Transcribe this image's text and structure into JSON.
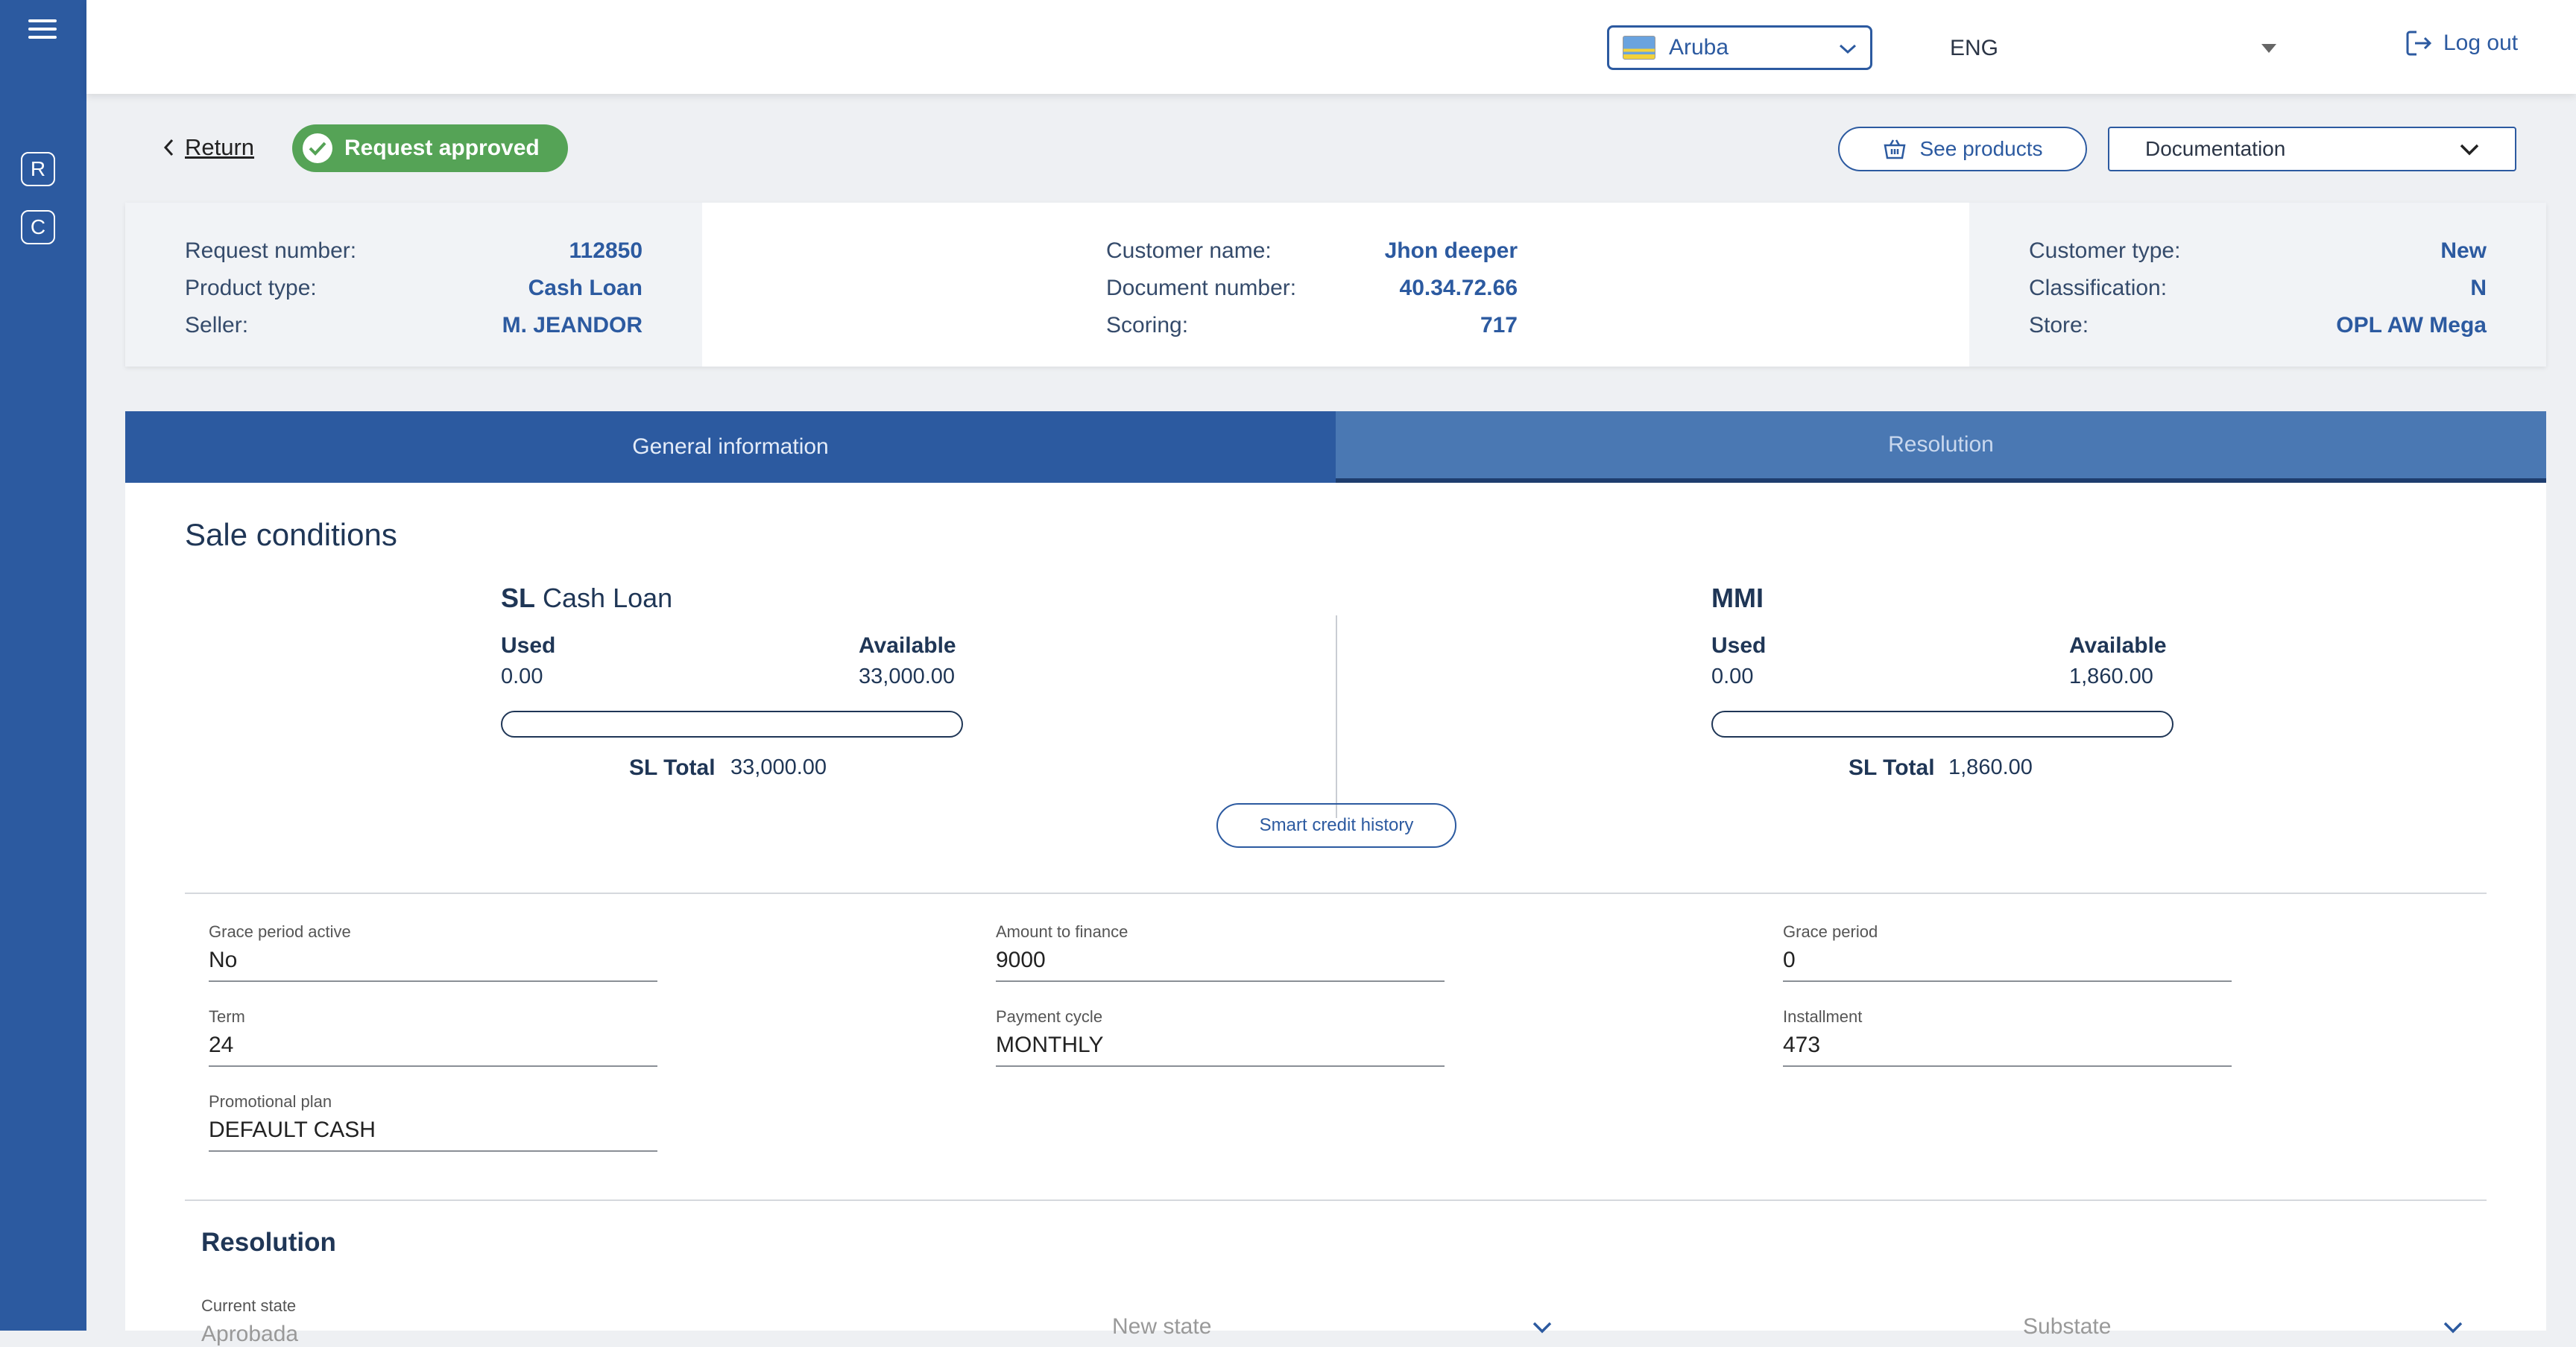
{
  "sidebar": {
    "menu_icon": "hamburger-menu-icon",
    "badges": [
      {
        "label": "R"
      },
      {
        "label": "C"
      }
    ]
  },
  "header": {
    "country": "Aruba",
    "language": "ENG",
    "logout": "Log out"
  },
  "actions": {
    "return": "Return",
    "status": "Request approved",
    "see_products": "See products",
    "documentation": "Documentation"
  },
  "summary": {
    "col1": [
      {
        "label": "Request number:",
        "value": "112850"
      },
      {
        "label": "Product type:",
        "value": "Cash Loan"
      },
      {
        "label": "Seller:",
        "value": "M. JEANDOR"
      }
    ],
    "col2": [
      {
        "label": "Customer name:",
        "value": "Jhon deeper"
      },
      {
        "label": "Document number:",
        "value": "40.34.72.66"
      },
      {
        "label": "Scoring:",
        "value": "717"
      }
    ],
    "col3": [
      {
        "label": "Customer type:",
        "value": "New"
      },
      {
        "label": "Classification:",
        "value": "N"
      },
      {
        "label": "Store:",
        "value": "OPL AW Mega"
      }
    ]
  },
  "tabs": [
    {
      "label": "General information"
    },
    {
      "label": "Resolution"
    }
  ],
  "sale": {
    "title": "Sale conditions",
    "credits": [
      {
        "code": "SL",
        "name": "Cash Loan",
        "used_label": "Used",
        "used": "0.00",
        "available_label": "Available",
        "available": "33,000.00",
        "used_fraction": 0,
        "total_label": "SL Total",
        "total": "33,000.00"
      },
      {
        "code": "MMI",
        "name": "",
        "used_label": "Used",
        "used": "0.00",
        "available_label": "Available",
        "available": "1,860.00",
        "used_fraction": 0,
        "total_label": "SL Total",
        "total": "1,860.00"
      }
    ],
    "smart_credit": "Smart credit history"
  },
  "fields": {
    "grace_active": {
      "label": "Grace period active",
      "value": "No"
    },
    "amount": {
      "label": "Amount to finance",
      "value": "9000"
    },
    "grace_period": {
      "label": "Grace period",
      "value": "0"
    },
    "term": {
      "label": "Term",
      "value": "24"
    },
    "payment_cycle": {
      "label": "Payment cycle",
      "value": "MONTHLY"
    },
    "installment": {
      "label": "Installment",
      "value": "473"
    },
    "promo": {
      "label": "Promotional plan",
      "value": "DEFAULT CASH"
    }
  },
  "resolution": {
    "title": "Resolution",
    "current_state_label": "Current state",
    "current_state": "Aprobada",
    "new_state": "New state",
    "substate": "Substate"
  },
  "colors": {
    "primary": "#2c5aa0",
    "tab_inactive": "#4a78b3",
    "approved": "#55a356"
  }
}
